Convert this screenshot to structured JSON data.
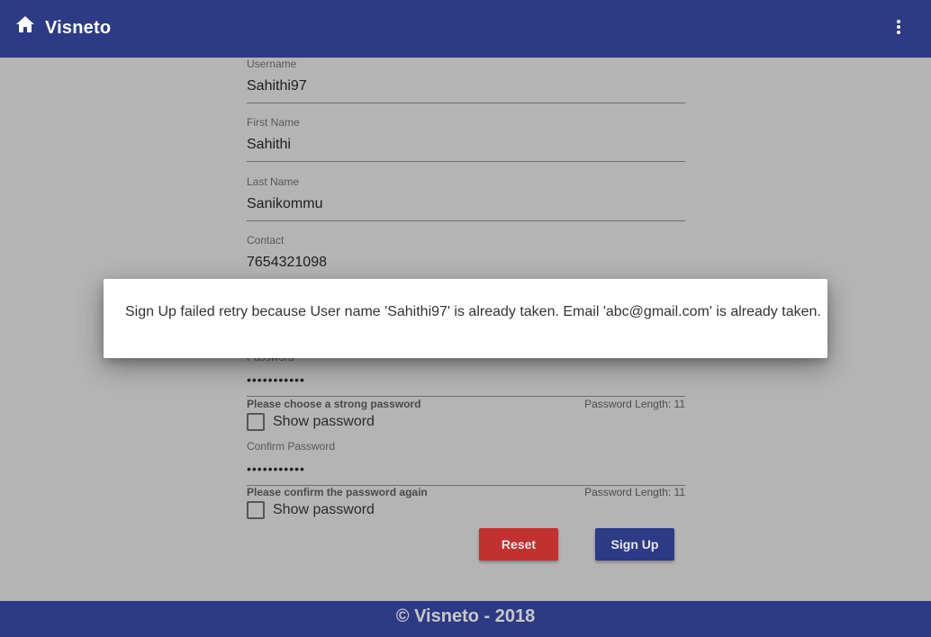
{
  "app": {
    "title": "Visneto"
  },
  "form": {
    "username": {
      "label": "Username",
      "value": "Sahithi97"
    },
    "first_name": {
      "label": "First Name",
      "value": "Sahithi"
    },
    "last_name": {
      "label": "Last Name",
      "value": "Sanikommu"
    },
    "contact": {
      "label": "Contact",
      "value": "7654321098"
    },
    "password": {
      "label": "Password",
      "value": "•••••••••••",
      "hint": "Please choose a strong password",
      "length_text": "Password Length: 11",
      "show_label": "Show password"
    },
    "confirm_password": {
      "label": "Confirm Password",
      "value": "•••••••••••",
      "hint": "Please confirm the password again",
      "length_text": "Password Length: 11",
      "show_label": "Show password"
    },
    "reset_label": "Reset",
    "signup_label": "Sign Up"
  },
  "dialog": {
    "message": "Sign Up failed retry because User name 'Sahithi97' is already taken. Email 'abc@gmail.com' is already taken."
  },
  "footer": {
    "text": "© Visneto - 2018"
  },
  "colors": {
    "primary": "#2d3a86",
    "danger": "#c1312e",
    "overlay": "#b4b4b4"
  },
  "icons": {
    "home": "home-icon",
    "menu": "more-vert-icon"
  }
}
